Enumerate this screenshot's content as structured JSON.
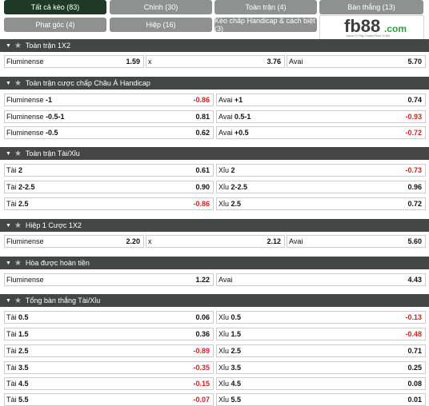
{
  "tabs": [
    {
      "label": "Tất cả kèo (83)",
      "active": true
    },
    {
      "label": "Chính (30)",
      "active": false
    },
    {
      "label": "Toàn trận (4)",
      "active": false
    },
    {
      "label": "Bàn thắng (13)",
      "active": false
    },
    {
      "label": "Phạt góc (4)",
      "active": false
    },
    {
      "label": "Hiệp (16)",
      "active": false
    },
    {
      "label": "Kèo chấp Handicap & cách biệt (3)",
      "active": false
    }
  ],
  "logo": {
    "text_main": "fb88",
    "text_tld": ".com",
    "tagline": "Games To Play  Trusted Place To Bet"
  },
  "colors": {
    "accent": "#1e3a27",
    "section_bg": "#444545",
    "negative": "#d42020",
    "tab_bg": "#8f9191"
  },
  "sections": [
    {
      "title": "Toàn trận 1X2",
      "rows": [
        [
          {
            "name": "Fluminense",
            "odd": "1.59"
          },
          {
            "name": "x",
            "odd": "3.76"
          },
          {
            "name": "Avai",
            "odd": "5.70"
          }
        ]
      ]
    },
    {
      "title": "Toàn trận cược chấp Châu Á Handicap",
      "rows": [
        [
          {
            "name": "Fluminense",
            "line": "-1",
            "odd": "-0.86"
          },
          {
            "name": "Avai",
            "line": "+1",
            "odd": "0.74"
          }
        ],
        [
          {
            "name": "Fluminense",
            "line": "-0.5-1",
            "odd": "0.81"
          },
          {
            "name": "Avai",
            "line": "0.5-1",
            "odd": "-0.93"
          }
        ],
        [
          {
            "name": "Fluminense",
            "line": "-0.5",
            "odd": "0.62"
          },
          {
            "name": "Avai",
            "line": "+0.5",
            "odd": "-0.72"
          }
        ]
      ]
    },
    {
      "title": "Toàn trận Tài/Xỉu",
      "rows": [
        [
          {
            "name": "Tài",
            "line": "2",
            "odd": "0.61"
          },
          {
            "name": "Xỉu",
            "line": "2",
            "odd": "-0.73"
          }
        ],
        [
          {
            "name": "Tài",
            "line": "2-2.5",
            "odd": "0.90"
          },
          {
            "name": "Xỉu",
            "line": "2-2.5",
            "odd": "0.96"
          }
        ],
        [
          {
            "name": "Tài",
            "line": "2.5",
            "odd": "-0.86"
          },
          {
            "name": "Xỉu",
            "line": "2.5",
            "odd": "0.72"
          }
        ]
      ]
    },
    {
      "title": "Hiệp 1 Cược 1X2",
      "rows": [
        [
          {
            "name": "Fluminense",
            "odd": "2.20"
          },
          {
            "name": "x",
            "odd": "2.12"
          },
          {
            "name": "Avai",
            "odd": "5.60"
          }
        ]
      ]
    },
    {
      "title": "Hòa được hoàn tiền",
      "rows": [
        [
          {
            "name": "Fluminense",
            "odd": "1.22"
          },
          {
            "name": "Avai",
            "odd": "4.43"
          }
        ]
      ]
    },
    {
      "title": "Tổng bàn thắng Tài/Xỉu",
      "rows": [
        [
          {
            "name": "Tài",
            "line": "0.5",
            "odd": "0.06"
          },
          {
            "name": "Xỉu",
            "line": "0.5",
            "odd": "-0.13"
          }
        ],
        [
          {
            "name": "Tài",
            "line": "1.5",
            "odd": "0.36"
          },
          {
            "name": "Xỉu",
            "line": "1.5",
            "odd": "-0.48"
          }
        ],
        [
          {
            "name": "Tài",
            "line": "2.5",
            "odd": "-0.89"
          },
          {
            "name": "Xỉu",
            "line": "2.5",
            "odd": "0.71"
          }
        ],
        [
          {
            "name": "Tài",
            "line": "3.5",
            "odd": "-0.35"
          },
          {
            "name": "Xỉu",
            "line": "3.5",
            "odd": "0.25"
          }
        ],
        [
          {
            "name": "Tài",
            "line": "4.5",
            "odd": "-0.15"
          },
          {
            "name": "Xỉu",
            "line": "4.5",
            "odd": "0.08"
          }
        ],
        [
          {
            "name": "Tài",
            "line": "5.5",
            "odd": "-0.07"
          },
          {
            "name": "Xỉu",
            "line": "5.5",
            "odd": "0.01"
          }
        ]
      ]
    }
  ]
}
